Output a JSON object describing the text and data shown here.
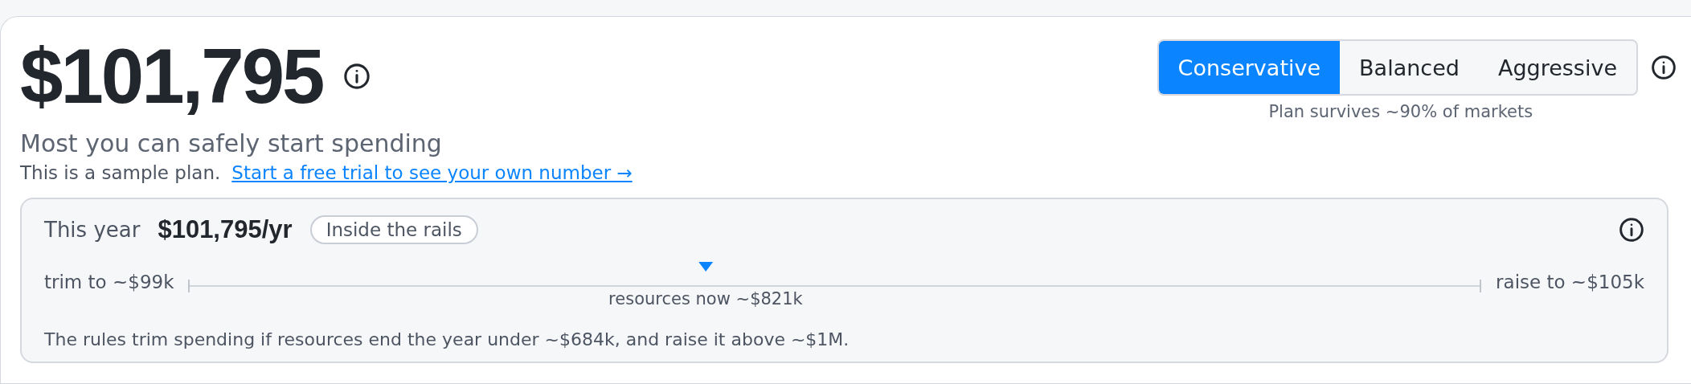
{
  "headline": {
    "amount": "$101,795",
    "caption": "Most you can safely start spending",
    "note": "This is a sample plan.",
    "link": "Start a free trial to see your own number →"
  },
  "strategy": {
    "options": [
      {
        "label": "Conservative",
        "selected": true
      },
      {
        "label": "Balanced",
        "selected": false
      },
      {
        "label": "Aggressive",
        "selected": false
      }
    ],
    "caption": "Plan survives ~90% of markets"
  },
  "this_year": {
    "label": "This year",
    "amount": "$101,795/yr",
    "badge": "Inside the rails",
    "low_label": "trim to ~$99k",
    "high_label": "raise to ~$105k",
    "marker": {
      "level": 0.4,
      "label": "resources now ~$821k"
    },
    "footnote": "The rules trim spending if resources end the year under ~$684k, and raise it above ~$1M."
  }
}
